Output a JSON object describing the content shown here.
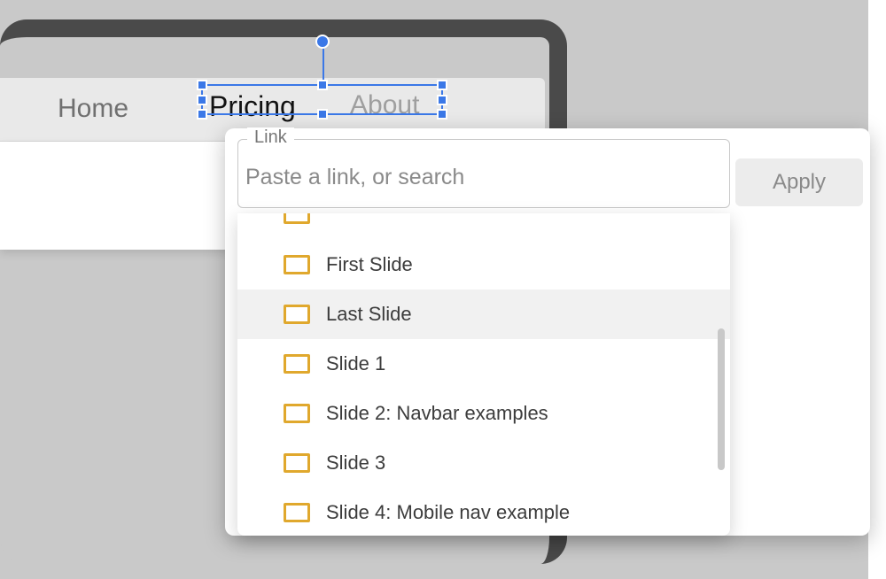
{
  "nav": {
    "home": "Home",
    "pricing": "Pricing",
    "about": "About"
  },
  "linkPopup": {
    "legend": "Link",
    "placeholder": "Paste a link, or search",
    "applyLabel": "Apply"
  },
  "dropdown": {
    "items": [
      {
        "label": ""
      },
      {
        "label": "First Slide"
      },
      {
        "label": "Last Slide"
      },
      {
        "label": "Slide 1"
      },
      {
        "label": "Slide 2: Navbar examples"
      },
      {
        "label": "Slide 3"
      },
      {
        "label": "Slide 4: Mobile nav example"
      }
    ],
    "hoveredIndex": 2
  }
}
